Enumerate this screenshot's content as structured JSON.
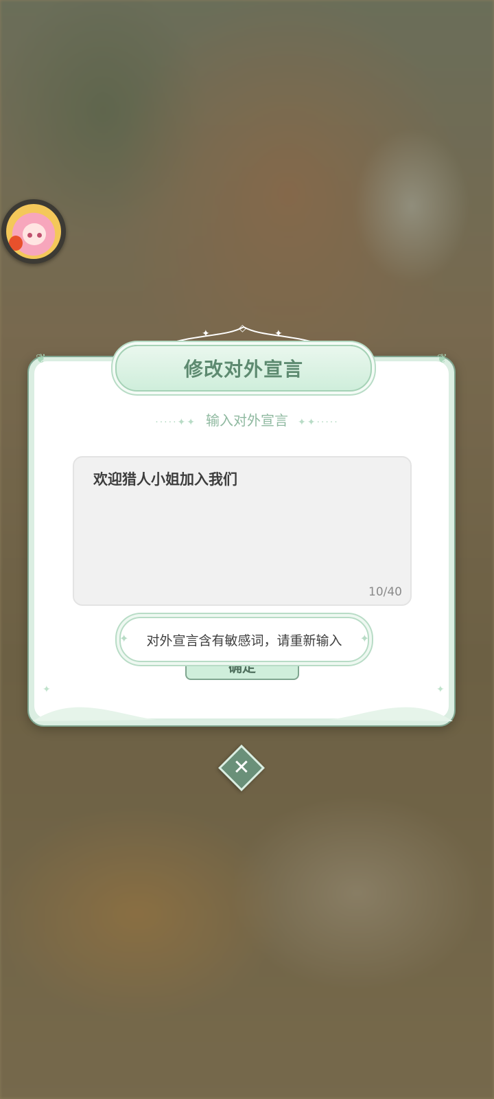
{
  "dialog": {
    "title": "修改对外宣言",
    "subtitle": "输入对外宣言",
    "input_value": "欢迎猎人小姐加入我们",
    "counter": "10/40",
    "confirm_label": "确定",
    "toast": "对外宣言含有敏感词，请重新输入"
  },
  "icons": {
    "close": "close-icon",
    "avatar": "avatar"
  },
  "colors": {
    "accent": "#7fa58f",
    "title": "#5d8a70",
    "panel_bg": "#ffffff"
  }
}
